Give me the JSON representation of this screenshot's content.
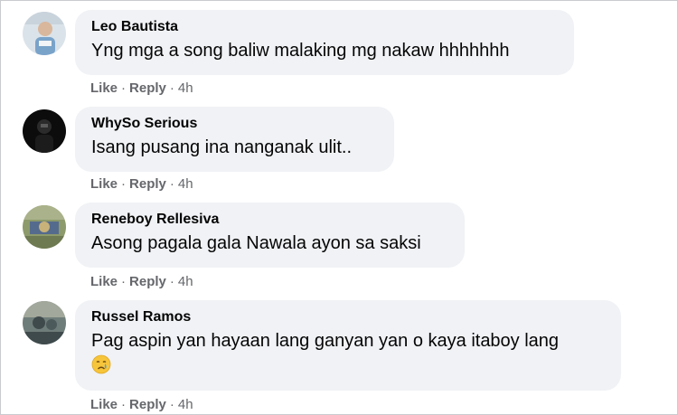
{
  "comments": [
    {
      "author": "Leo Bautista",
      "text": "Yng mga a song baliw malaking mg nakaw hhhhhhh",
      "like": "Like",
      "reply": "Reply",
      "time": "4h",
      "avatar_icon": "user-photo-icon",
      "avatar_colors": [
        "#dbe3ea",
        "#7aa3c9",
        "#f2f4f7"
      ]
    },
    {
      "author": "WhySo Serious",
      "text": "Isang pusang ina nanganak ulit..",
      "like": "Like",
      "reply": "Reply",
      "time": "4h",
      "avatar_icon": "user-photo-icon",
      "avatar_colors": [
        "#0c0c0c",
        "#2b2b2b",
        "#5a5a5a"
      ]
    },
    {
      "author": "Reneboy Rellesiva",
      "text": "Asong pagala gala Nawala ayon sa saksi",
      "like": "Like",
      "reply": "Reply",
      "time": "4h",
      "avatar_icon": "user-photo-icon",
      "avatar_colors": [
        "#8d9a6b",
        "#556b8d",
        "#c8b27a"
      ]
    },
    {
      "author": "Russel Ramos",
      "text": "Pag aspin yan hayaan lang ganyan yan o kaya itaboy lang",
      "emoji": "crying-face-emoji",
      "like": "Like",
      "reply": "Reply",
      "time": "4h",
      "avatar_icon": "user-photo-icon",
      "avatar_colors": [
        "#6f7d7a",
        "#3f4a4c",
        "#a2a89b"
      ]
    }
  ],
  "colors": {
    "bubble_bg": "#f0f2f5",
    "text": "#050505",
    "meta": "#65676b"
  }
}
